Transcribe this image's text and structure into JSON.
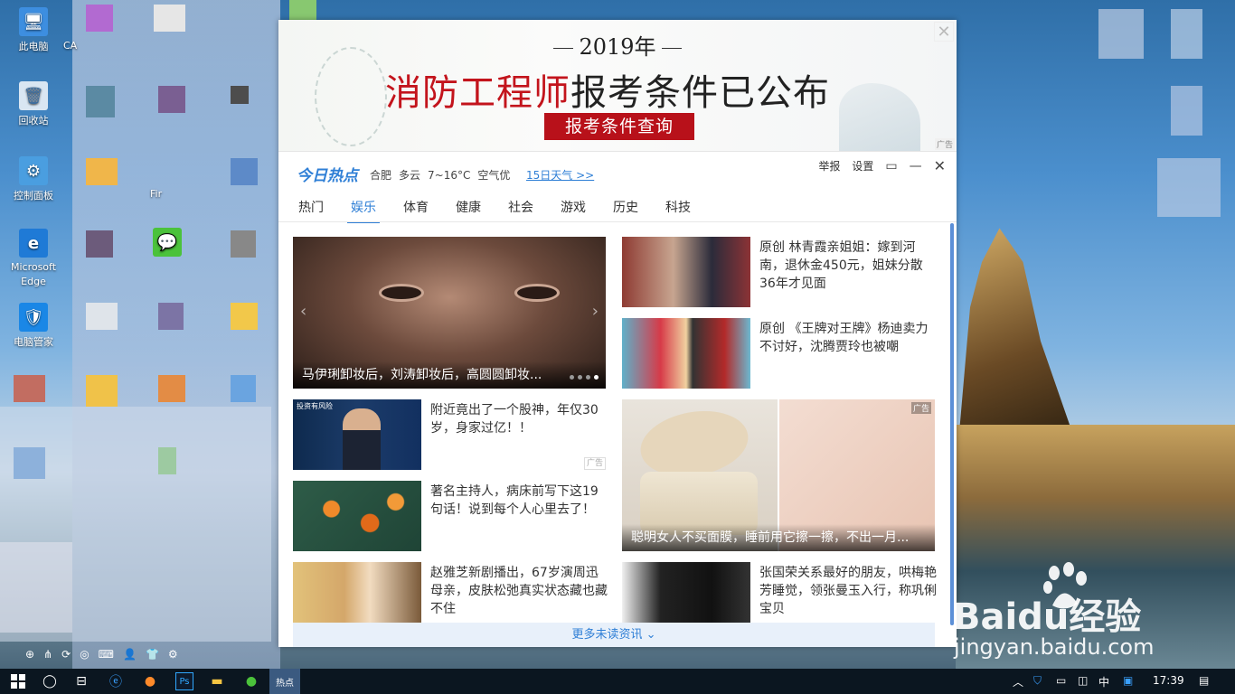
{
  "desktop": {
    "icons": [
      {
        "label": "此电脑",
        "glyph": "🖥"
      },
      {
        "label": "回收站",
        "glyph": "🗑"
      },
      {
        "label": "控制面板",
        "glyph": "⚙"
      },
      {
        "label": "Microsoft Edge",
        "glyph": "e"
      },
      {
        "label": "电脑管家",
        "glyph": "🛡"
      }
    ],
    "partial_labels": {
      "ca": "CA",
      "fir": "Fir"
    }
  },
  "banner": {
    "year": "2019年",
    "headline_red": "消防工程师",
    "headline_dark": "报考条件已公布",
    "cta": "报考条件查询",
    "ad_tag": "广告"
  },
  "header": {
    "logo": "今日热点",
    "city": "合肥",
    "weather": "多云",
    "temp": "7~16°C",
    "air": "空气优",
    "forecast_link": "15日天气 >>",
    "report": "举报",
    "settings": "设置"
  },
  "tabs": [
    "热门",
    "娱乐",
    "体育",
    "健康",
    "社会",
    "游戏",
    "历史",
    "科技"
  ],
  "active_tab": "娱乐",
  "hero": {
    "caption": "马伊琍卸妆后，刘涛卸妆后，高圆圆卸妆...",
    "dots": 4,
    "active_dot": 4
  },
  "news_left": [
    {
      "title": "附近竟出了一个股神，年仅30岁，身家过亿！！",
      "ad": "广告",
      "thumb_label": "投资有风险"
    },
    {
      "title": "著名主持人，病床前写下这19句话！说到每个人心里去了！"
    },
    {
      "title": "赵雅芝新剧播出，67岁演周迅母亲，皮肤松弛真实状态藏也藏不住"
    }
  ],
  "news_right": [
    {
      "title": "原创 林青霞亲姐姐：嫁到河南，退休金450元，姐妹分散36年才见面"
    },
    {
      "title": "原创 《王牌对王牌》杨迪卖力不讨好，沈腾贾玲也被嘲"
    },
    {
      "title": "张国荣关系最好的朋友，哄梅艳芳睡觉，领张曼玉入行，称巩俐宝贝"
    }
  ],
  "big_ad": {
    "caption": "聪明女人不买面膜，睡前用它擦一擦，不出一月...",
    "ad": "广告"
  },
  "more": "更多未读资讯",
  "taskbar": {
    "ime": "中",
    "time": "17:39"
  },
  "watermark": {
    "brand_a": "Bai",
    "brand_b": "du",
    "brand_c": "经验",
    "url": "jingyan.baidu.com"
  }
}
